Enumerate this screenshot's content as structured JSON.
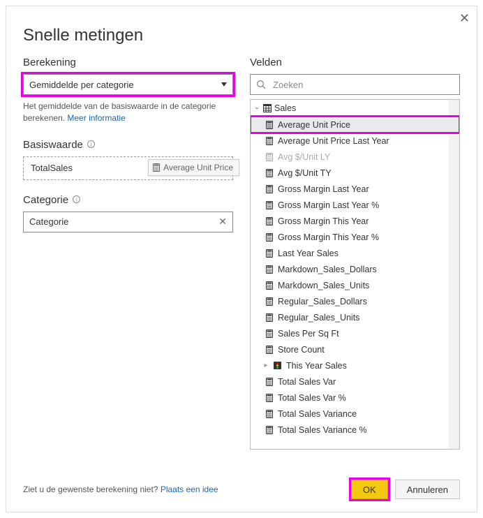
{
  "title": "Snelle metingen",
  "left": {
    "berekening_label": "Berekening",
    "select_value": "Gemiddelde per categorie",
    "desc_text": "Het gemiddelde van de basiswaarde in de categorie berekenen.  ",
    "desc_link": "Meer informatie",
    "basiswaarde_label": "Basiswaarde",
    "basiswaarde_value": "TotalSales",
    "drag_chip_label": "Average Unit Price",
    "categorie_label": "Categorie",
    "categorie_value": "Categorie"
  },
  "right": {
    "velden_label": "Velden",
    "search_placeholder": "Zoeken",
    "table_name": "Sales",
    "fields": [
      {
        "label": "Average Unit Price",
        "kind": "calc",
        "selected": true
      },
      {
        "label": "Average Unit Price Last Year",
        "kind": "calc"
      },
      {
        "label": "Avg $/Unit LY",
        "kind": "calc",
        "disabled": true
      },
      {
        "label": "Avg $/Unit TY",
        "kind": "calc"
      },
      {
        "label": "Gross Margin Last Year",
        "kind": "calc"
      },
      {
        "label": "Gross Margin Last Year %",
        "kind": "calc"
      },
      {
        "label": "Gross Margin This Year",
        "kind": "calc"
      },
      {
        "label": "Gross Margin This Year %",
        "kind": "calc"
      },
      {
        "label": "Last Year Sales",
        "kind": "calc"
      },
      {
        "label": "Markdown_Sales_Dollars",
        "kind": "calc"
      },
      {
        "label": "Markdown_Sales_Units",
        "kind": "calc"
      },
      {
        "label": "Regular_Sales_Dollars",
        "kind": "calc"
      },
      {
        "label": "Regular_Sales_Units",
        "kind": "calc"
      },
      {
        "label": "Sales Per Sq Ft",
        "kind": "calc"
      },
      {
        "label": "Store Count",
        "kind": "calc"
      },
      {
        "label": "This Year Sales",
        "kind": "kpi"
      },
      {
        "label": "Total Sales Var",
        "kind": "calc"
      },
      {
        "label": "Total Sales Var %",
        "kind": "calc"
      },
      {
        "label": "Total Sales Variance",
        "kind": "calc"
      },
      {
        "label": "Total Sales Variance %",
        "kind": "calc"
      }
    ]
  },
  "footer": {
    "text": "Ziet u de gewenste berekening niet? ",
    "link": "Plaats een idee",
    "ok": "OK",
    "cancel": "Annuleren"
  }
}
